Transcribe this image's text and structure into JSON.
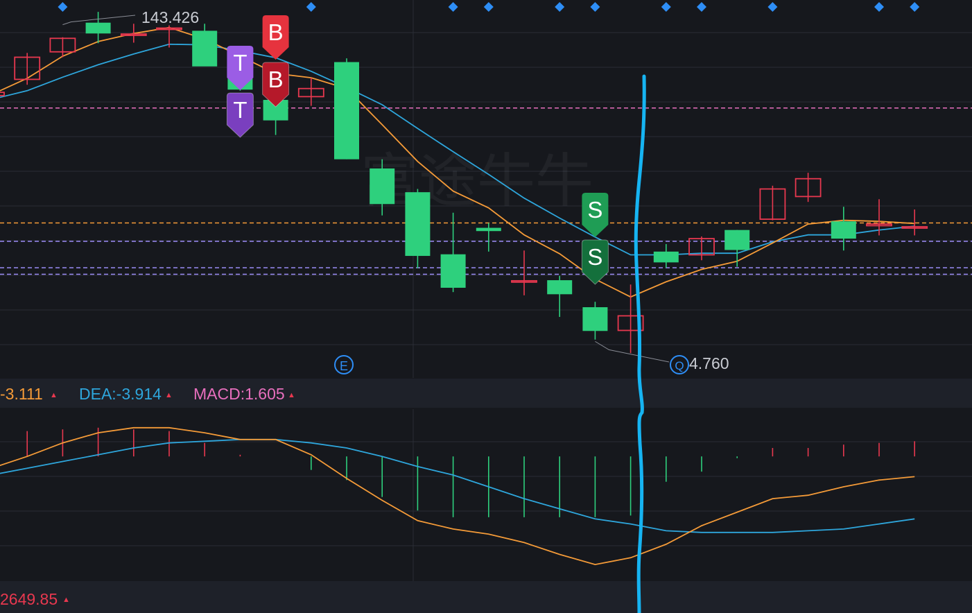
{
  "colors": {
    "background": "#16181d",
    "panel_bg": "#1e2129",
    "grid": "#2a2d35",
    "up": "#e8384f",
    "down": "#2ed07d",
    "ma_fast": "#f59b38",
    "ma_slow": "#2ea6dc",
    "dif": "#f59b38",
    "dea": "#2ea6dc",
    "macd_text": "#e86fbe",
    "marker_diamond": "#2e8ef6",
    "hline_pink": "#e86fbe",
    "hline_orange": "#f59b38",
    "hline_purple": "#9b8cf6",
    "tag_T": "#9b5de5",
    "tag_B": "#e6333e",
    "tag_S": "#1f9d55",
    "drawn_line": "#16b4f2",
    "watermark": "#ffffff"
  },
  "labels": {
    "high_price": "143.426",
    "low_price": "4.760",
    "event_icon": "E",
    "search_icon": "Q",
    "dif_label": "-3.111",
    "dea_label": "DEA:-3.914",
    "macd_label": "MACD:1.605",
    "bottom_value": "2649.85",
    "arrow_up": "▲",
    "watermark_text": "富途牛牛",
    "tag_t": "T",
    "tag_b": "B",
    "tag_s": "S"
  },
  "chart_data": [
    {
      "type": "candlestick",
      "title": "",
      "candles": [
        {
          "o": 130.3,
          "h": 132.3,
          "l": 128.6,
          "c": 130.9
        },
        {
          "o": 133.3,
          "h": 138.2,
          "l": 132.3,
          "c": 137.4
        },
        {
          "o": 138.4,
          "h": 141.1,
          "l": 137.4,
          "c": 140.9
        },
        {
          "o": 143.8,
          "h": 145.8,
          "l": 140.0,
          "c": 141.8
        },
        {
          "o": 141.7,
          "h": 143.6,
          "l": 140.1,
          "c": 141.7
        },
        {
          "o": 142.6,
          "h": 143.3,
          "l": 139.2,
          "c": 142.8
        },
        {
          "o": 142.3,
          "h": 143.6,
          "l": 135.9,
          "c": 135.7
        },
        {
          "o": 136.4,
          "h": 138.8,
          "l": 131.2,
          "c": 131.4
        },
        {
          "o": 129.5,
          "h": 129.5,
          "l": 123.0,
          "c": 125.7
        },
        {
          "o": 130.1,
          "h": 133.6,
          "l": 128.4,
          "c": 131.6
        },
        {
          "o": 136.5,
          "h": 137.2,
          "l": 118.5,
          "c": 118.5
        },
        {
          "o": 116.8,
          "h": 118.5,
          "l": 108.1,
          "c": 110.2
        },
        {
          "o": 112.4,
          "h": 113.0,
          "l": 98.3,
          "c": 100.6
        },
        {
          "o": 100.9,
          "h": 108.6,
          "l": 93.9,
          "c": 94.7
        },
        {
          "o": 105.8,
          "h": 106.7,
          "l": 101.4,
          "c": 105.2
        },
        {
          "o": 96.0,
          "h": 101.6,
          "l": 93.3,
          "c": 96.0
        },
        {
          "o": 96.1,
          "h": 96.9,
          "l": 89.3,
          "c": 93.5
        },
        {
          "o": 91.1,
          "h": 92.1,
          "l": 85.1,
          "c": 86.7
        },
        {
          "o": 86.8,
          "h": 95.3,
          "l": 82.6,
          "c": 89.5
        },
        {
          "o": 101.4,
          "h": 102.8,
          "l": 98.4,
          "c": 99.4
        },
        {
          "o": 100.8,
          "h": 104.2,
          "l": 99.8,
          "c": 103.8
        },
        {
          "o": 105.4,
          "h": 105.4,
          "l": 98.6,
          "c": 101.7
        },
        {
          "o": 107.4,
          "h": 113.6,
          "l": 107.2,
          "c": 113.0
        },
        {
          "o": 111.6,
          "h": 116.0,
          "l": 110.6,
          "c": 114.9
        },
        {
          "o": 107.0,
          "h": 109.7,
          "l": 101.6,
          "c": 103.8
        },
        {
          "o": 106.2,
          "h": 111.1,
          "l": 104.4,
          "c": 106.5
        },
        {
          "o": 105.8,
          "h": 109.2,
          "l": 104.4,
          "c": 106.0
        }
      ],
      "ma_fast": [
        130.5,
        133.5,
        137.6,
        140.3,
        141.8,
        142.9,
        140.8,
        137.6,
        134.4,
        133.6,
        131.6,
        124.9,
        118.1,
        112.6,
        109.5,
        104.5,
        101.0,
        96.3,
        93.0,
        95.8,
        98.1,
        99.6,
        103.0,
        106.5,
        107.2,
        107.0,
        106.6
      ],
      "ma_slow": [
        129.6,
        131.2,
        133.7,
        136.0,
        138.0,
        139.8,
        139.7,
        138.6,
        137.3,
        134.8,
        131.8,
        128.6,
        124.2,
        119.9,
        115.7,
        111.3,
        107.6,
        104.1,
        100.8,
        100.8,
        101.1,
        101.1,
        103.2,
        104.5,
        104.5,
        105.4,
        106.1
      ],
      "horizontal_levels": [
        {
          "value": 128.0,
          "color": "pink"
        },
        {
          "value": 106.7,
          "color": "orange"
        },
        {
          "value": 103.3,
          "color": "purple"
        },
        {
          "value": 98.4,
          "color": "purple"
        },
        {
          "value": 97.2,
          "color": "purple"
        }
      ],
      "high_marker": {
        "index": 2,
        "value": 143.426
      },
      "low_marker": {
        "index": 17,
        "value": 84.76
      },
      "signals": [
        {
          "index": 7,
          "tag": "T",
          "count": 2
        },
        {
          "index": 8,
          "tag": "B",
          "count": 2
        },
        {
          "index": 17,
          "tag": "S",
          "count": 2
        }
      ],
      "event_markers_index": [
        9,
        18
      ],
      "top_diamonds_index": [
        2,
        9,
        13,
        14,
        16,
        17,
        19,
        20,
        22,
        25,
        26
      ],
      "ylim": [
        78,
        148
      ]
    },
    {
      "type": "macd",
      "dif": [
        -0.7,
        0.0,
        0.8,
        1.4,
        1.7,
        1.7,
        1.4,
        1.0,
        1.0,
        0.1,
        -1.3,
        -2.6,
        -3.8,
        -4.3,
        -4.6,
        -5.1,
        -5.8,
        -6.4,
        -6.0,
        -5.2,
        -4.1,
        -3.3,
        -2.5,
        -2.3,
        -1.8,
        -1.4,
        -1.2
      ],
      "dea": [
        -1.1,
        -0.7,
        -0.3,
        0.1,
        0.5,
        0.8,
        0.9,
        1.0,
        1.0,
        0.8,
        0.5,
        0.0,
        -0.6,
        -1.1,
        -1.8,
        -2.5,
        -3.1,
        -3.7,
        -4.0,
        -4.4,
        -4.5,
        -4.5,
        -4.5,
        -4.4,
        -4.3,
        -4.0,
        -3.7
      ],
      "histogram": [
        1.3,
        1.5,
        1.6,
        1.7,
        1.6,
        1.5,
        0.8,
        0.1,
        0.0,
        -0.8,
        -1.4,
        -2.4,
        -3.2,
        -3.6,
        -3.6,
        -3.6,
        -3.6,
        -3.6,
        -3.5,
        -1.5,
        -0.9,
        -0.1,
        0.5,
        0.5,
        0.7,
        0.8,
        0.9
      ],
      "ylim": [
        -7.3,
        2.8
      ]
    }
  ]
}
